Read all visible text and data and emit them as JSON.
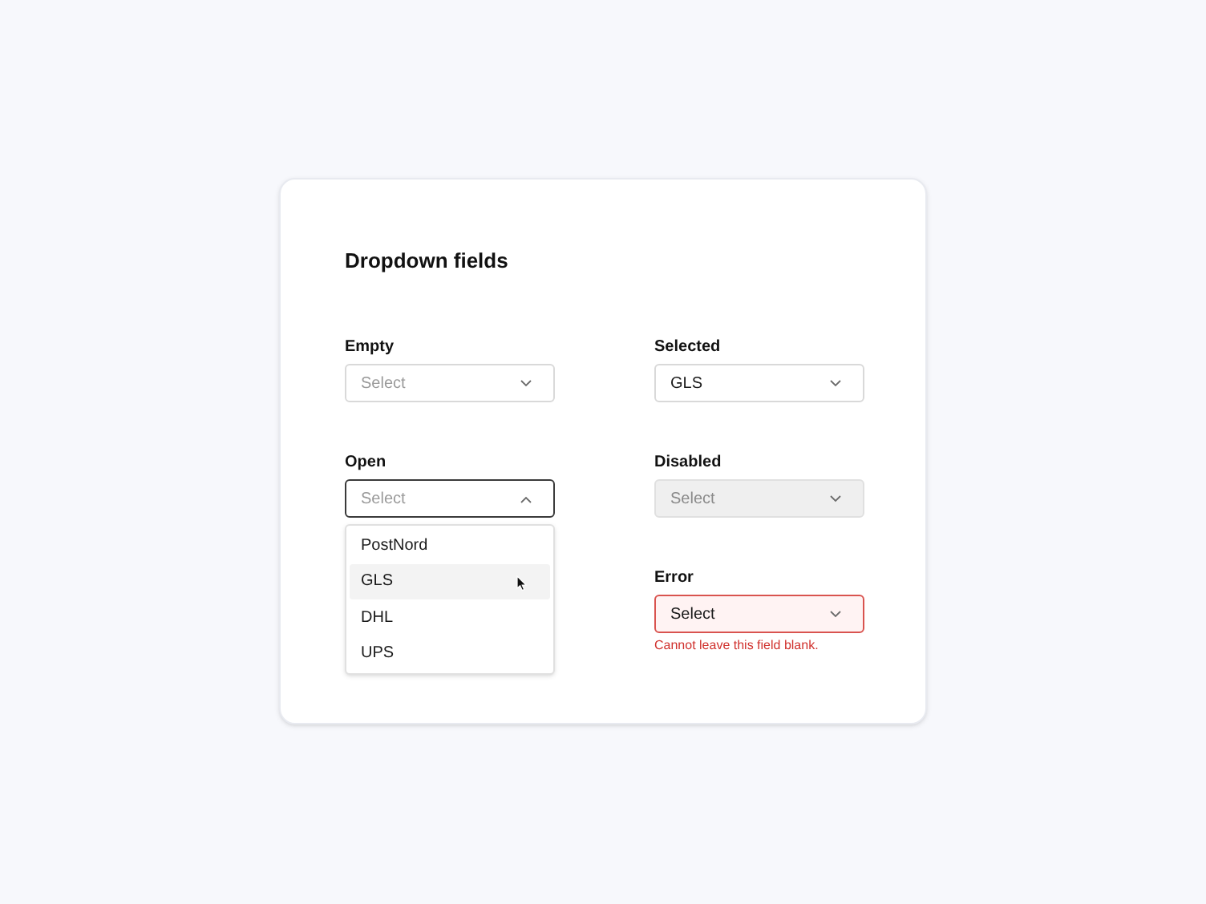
{
  "title": "Dropdown fields",
  "columns": [
    [
      {
        "kind": "empty",
        "label": "Empty",
        "placeholder": "Select"
      },
      {
        "kind": "open",
        "label": "Open",
        "placeholder": "Select",
        "options": [
          {
            "label": "PostNord",
            "selected": false
          },
          {
            "label": "GLS",
            "selected": true
          },
          {
            "label": "DHL",
            "selected": false
          },
          {
            "label": "UPS",
            "selected": false
          }
        ]
      }
    ],
    [
      {
        "kind": "selected",
        "label": "Selected",
        "value": "GLS"
      },
      {
        "kind": "disabled",
        "label": "Disabled",
        "placeholder": "Select"
      },
      {
        "kind": "error",
        "label": "Error",
        "value": "Select",
        "error": "Cannot leave this field blank."
      }
    ]
  ]
}
